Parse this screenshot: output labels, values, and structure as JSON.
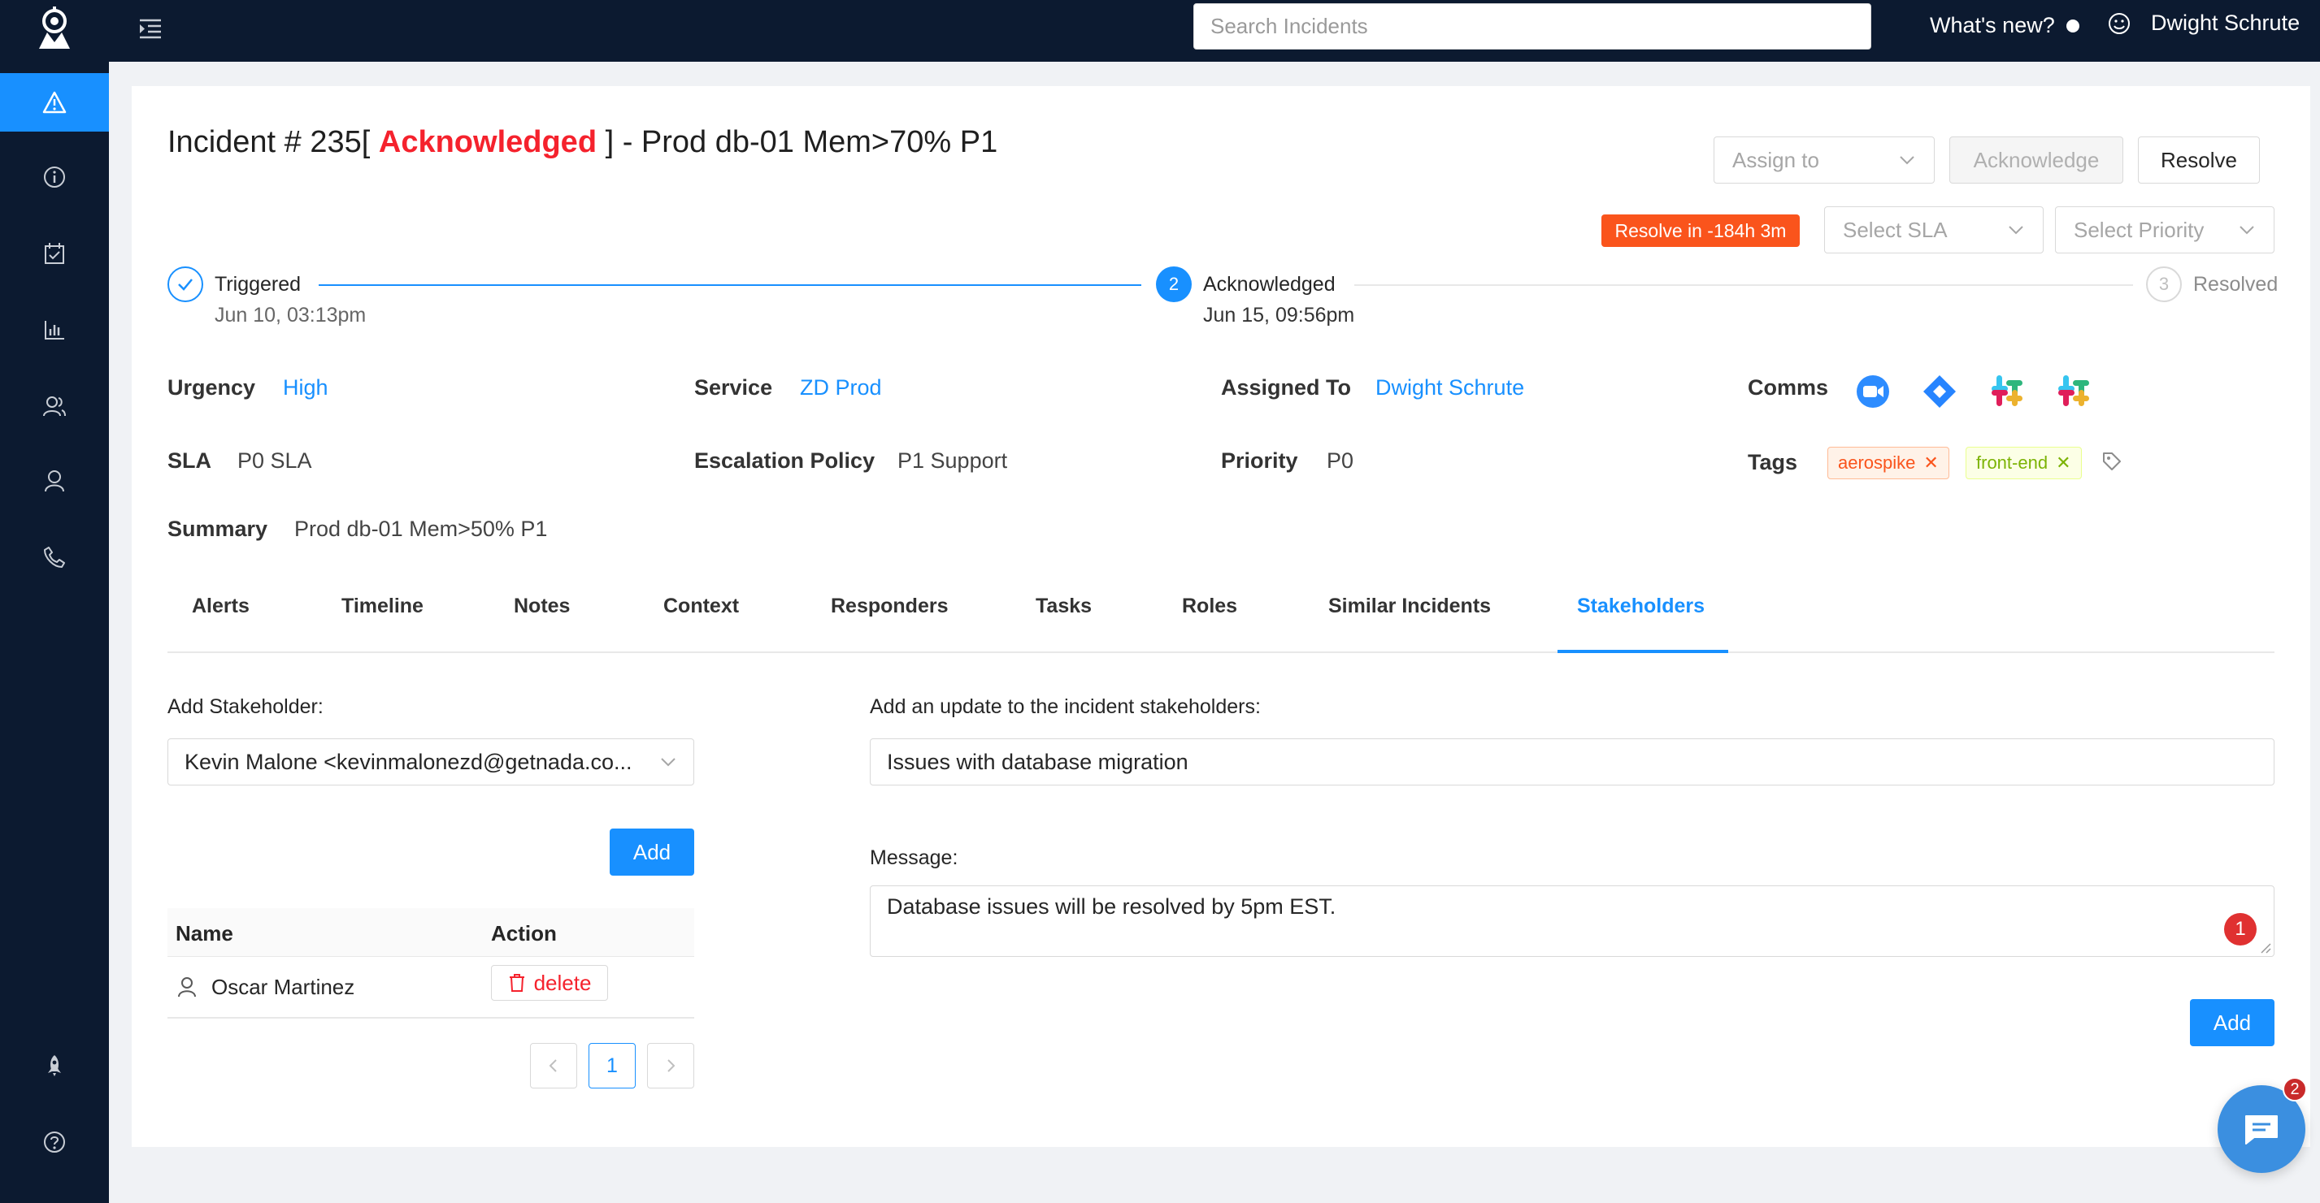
{
  "header": {
    "search_placeholder": "Search Incidents",
    "whats_new": "What's new?",
    "user_name": "Dwight Schrute"
  },
  "sidebar": {
    "items": [
      {
        "icon": "alert-icon",
        "active": true
      },
      {
        "icon": "info-icon"
      },
      {
        "icon": "calendar-check-icon"
      },
      {
        "icon": "bar-chart-icon"
      },
      {
        "icon": "team-icon"
      },
      {
        "icon": "user-icon"
      },
      {
        "icon": "phone-icon"
      },
      {
        "icon": "rocket-icon"
      },
      {
        "icon": "help-icon"
      }
    ]
  },
  "incident": {
    "title_prefix": "Incident # 235[",
    "status": "Acknowledged",
    "title_suffix": "] - Prod db-01 Mem>70% P1",
    "assign_to": "Assign to",
    "acknowledge": "Acknowledge",
    "resolve": "Resolve",
    "resolve_in": "Resolve in -184h 3m",
    "select_sla": "Select SLA",
    "select_priority": "Select Priority"
  },
  "steps": [
    {
      "title": "Triggered",
      "desc": "Jun 10, 03:13pm",
      "state": "done"
    },
    {
      "number": "2",
      "title": "Acknowledged",
      "desc": "Jun 15, 09:56pm",
      "state": "active"
    },
    {
      "number": "3",
      "title": "Resolved",
      "desc": "",
      "state": "wait"
    }
  ],
  "details": {
    "urgency_label": "Urgency",
    "urgency": "High",
    "service_label": "Service",
    "service": "ZD Prod",
    "assigned_label": "Assigned To",
    "assigned": "Dwight Schrute",
    "comms_label": "Comms",
    "comms": [
      "zoom-icon",
      "jira-icon",
      "slack-icon",
      "slack-icon"
    ],
    "sla_label": "SLA",
    "sla": "P0 SLA",
    "escalation_label": "Escalation Policy",
    "escalation": "P1 Support",
    "priority_label": "Priority",
    "priority": "P0",
    "tags_label": "Tags",
    "tags": [
      "aerospike",
      "front-end"
    ],
    "summary_label": "Summary",
    "summary": "Prod db-01 Mem>50% P1"
  },
  "tabs": [
    "Alerts",
    "Timeline",
    "Notes",
    "Context",
    "Responders",
    "Tasks",
    "Roles",
    "Similar Incidents",
    "Stakeholders"
  ],
  "active_tab": "Stakeholders",
  "stakeholders": {
    "add_label": "Add Stakeholder",
    "selected": "Kevin Malone <kevinmalonezd@getnada.co...",
    "add_button": "Add",
    "table_headers": [
      "Name",
      "Action"
    ],
    "rows": [
      {
        "name": "Oscar Martinez",
        "action": "delete"
      }
    ],
    "current_page": "1"
  },
  "update": {
    "subject_label": "Add an update to the incident stakeholders",
    "subject": "Issues with database migration",
    "message_label": "Message",
    "message": "Database issues will be resolved by 5pm EST.",
    "message_badge": "1",
    "add_button": "Add"
  },
  "chat": {
    "badge": "2"
  },
  "colors": {
    "primary": "#1890ff",
    "danger": "#f5222d",
    "nav_bg": "#0c1a30",
    "badge_orange": "#fa541c"
  }
}
